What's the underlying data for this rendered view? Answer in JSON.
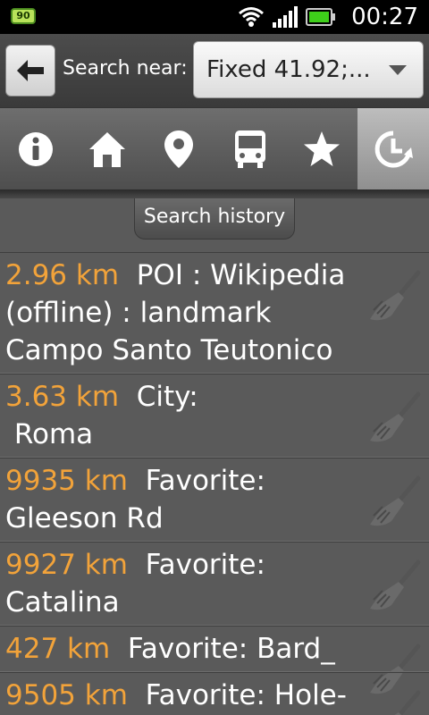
{
  "status_bar": {
    "battery_badge": "90",
    "time": "00:27",
    "icons": [
      "wifi-icon",
      "signal-icon",
      "battery-icon"
    ]
  },
  "header": {
    "back_icon": "arrow-left-icon",
    "search_near_label": "Search near:",
    "search_near_value": "Fixed 41.92;..."
  },
  "tabs": [
    {
      "icon": "info-icon",
      "active": false
    },
    {
      "icon": "home-icon",
      "active": false
    },
    {
      "icon": "location-pin-icon",
      "active": false
    },
    {
      "icon": "bus-icon",
      "active": false
    },
    {
      "icon": "star-icon",
      "active": false
    },
    {
      "icon": "history-icon",
      "active": true
    }
  ],
  "section_label": "Search history",
  "colors": {
    "distance": "#f2a33a",
    "background": "#5a5a5a"
  },
  "history": [
    {
      "distance": "2.96 km",
      "text": "POI : Wikipedia\n(offline) : landmark\nCampo Santo Teutonico"
    },
    {
      "distance": "3.63 km",
      "text": "City:\n Roma"
    },
    {
      "distance": "9935 km",
      "text": "Favorite:\nGleeson Rd"
    },
    {
      "distance": "9927 km",
      "text": "Favorite:\nCatalina"
    },
    {
      "distance": "427 km",
      "text": "Favorite: Bard_"
    },
    {
      "distance": "9505 km",
      "text": "Favorite: Hole-"
    }
  ]
}
